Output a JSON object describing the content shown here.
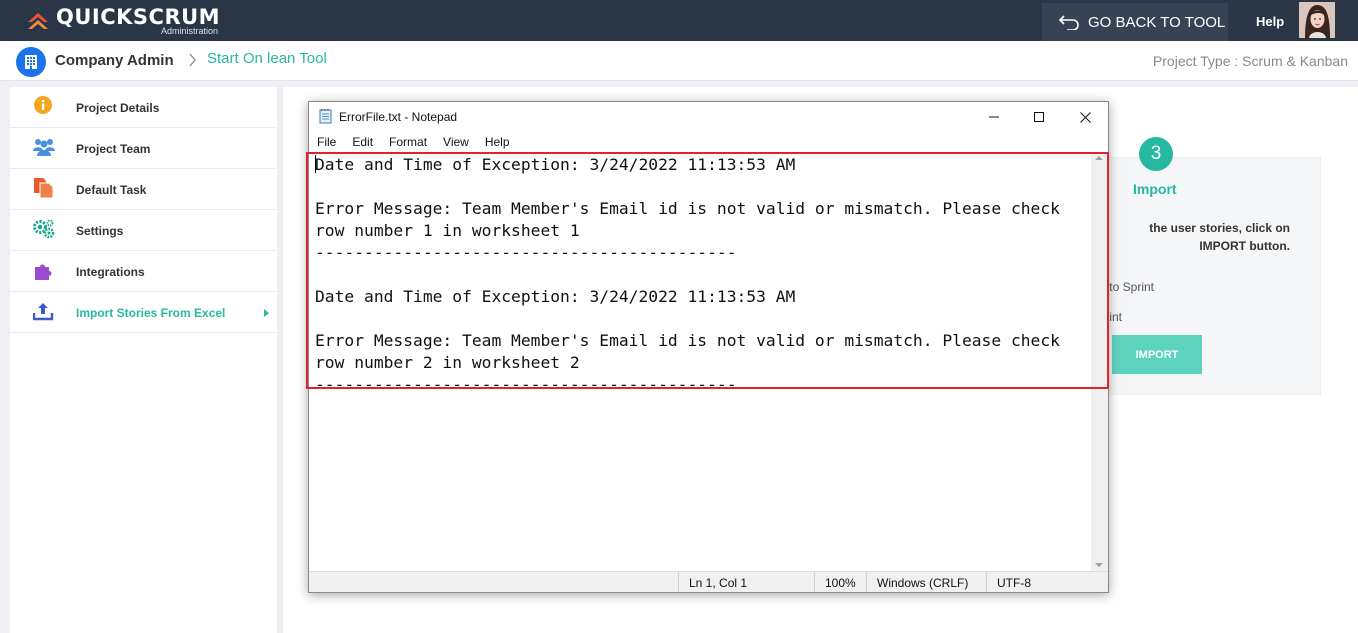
{
  "app": {
    "brand": "Quickscrum",
    "brand_sub": "Administration",
    "back_to_tool": "GO BACK TO TOOL",
    "help": "Help"
  },
  "breadcrumb": {
    "company": "Company Admin",
    "current": "Start On lean Tool",
    "project_type": "Project Type : Scrum & Kanban"
  },
  "sidebar": {
    "items": [
      {
        "label": "Project Details",
        "icon": "info-icon"
      },
      {
        "label": "Project Team",
        "icon": "team-icon"
      },
      {
        "label": "Default Task",
        "icon": "task-icon"
      },
      {
        "label": "Settings",
        "icon": "gears-icon"
      },
      {
        "label": "Integrations",
        "icon": "puzzle-icon"
      },
      {
        "label": "Import Stories From Excel",
        "icon": "upload-icon",
        "active": true
      }
    ]
  },
  "import_step": {
    "number": "3",
    "title": "Import",
    "description": "the user stories, click on\nIMPORT button.",
    "option1": "to Sprint",
    "option2": "int",
    "button": "IMPORT"
  },
  "notepad": {
    "title": "ErrorFile.txt - Notepad",
    "menu": [
      "File",
      "Edit",
      "Format",
      "View",
      "Help"
    ],
    "content": "Date and Time of Exception: 3/24/2022 11:13:53 AM\n\nError Message: Team Member's Email id is not valid or mismatch. Please check\nrow number 1 in worksheet 1\n-------------------------------------------\n\nDate and Time of Exception: 3/24/2022 11:13:53 AM\n\nError Message: Team Member's Email id is not valid or mismatch. Please check\nrow number 2 in worksheet 2\n-------------------------------------------",
    "status": {
      "position": "Ln 1, Col 1",
      "zoom": "100%",
      "line_ending": "Windows (CRLF)",
      "encoding": "UTF-8"
    }
  },
  "colors": {
    "topbar": "#2a3545",
    "accent": "#26b8a0",
    "highlight": "#e0222a"
  }
}
